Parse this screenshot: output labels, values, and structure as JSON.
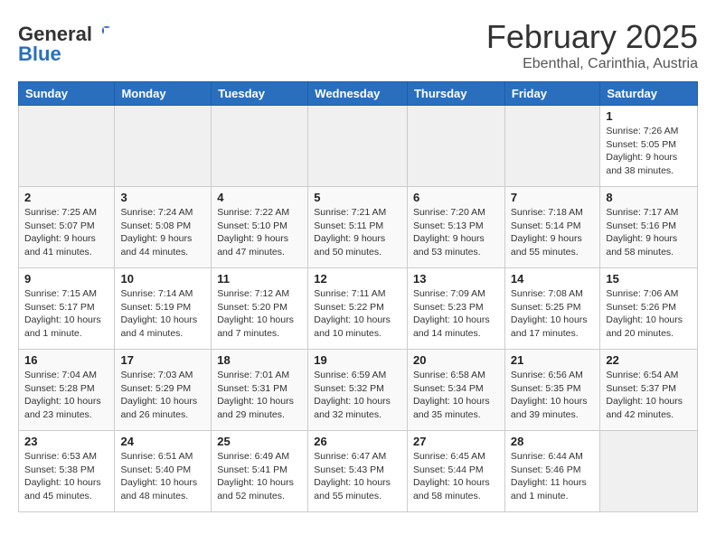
{
  "header": {
    "logo_line1": "General",
    "logo_line2": "Blue",
    "calendar_title": "February 2025",
    "calendar_subtitle": "Ebenthal, Carinthia, Austria"
  },
  "weekdays": [
    "Sunday",
    "Monday",
    "Tuesday",
    "Wednesday",
    "Thursday",
    "Friday",
    "Saturday"
  ],
  "weeks": [
    [
      {
        "day": null
      },
      {
        "day": null
      },
      {
        "day": null
      },
      {
        "day": null
      },
      {
        "day": null
      },
      {
        "day": null
      },
      {
        "day": "1",
        "sunrise": "7:26 AM",
        "sunset": "5:05 PM",
        "daylight": "9 hours and 38 minutes."
      }
    ],
    [
      {
        "day": "2",
        "sunrise": "7:25 AM",
        "sunset": "5:07 PM",
        "daylight": "9 hours and 41 minutes."
      },
      {
        "day": "3",
        "sunrise": "7:24 AM",
        "sunset": "5:08 PM",
        "daylight": "9 hours and 44 minutes."
      },
      {
        "day": "4",
        "sunrise": "7:22 AM",
        "sunset": "5:10 PM",
        "daylight": "9 hours and 47 minutes."
      },
      {
        "day": "5",
        "sunrise": "7:21 AM",
        "sunset": "5:11 PM",
        "daylight": "9 hours and 50 minutes."
      },
      {
        "day": "6",
        "sunrise": "7:20 AM",
        "sunset": "5:13 PM",
        "daylight": "9 hours and 53 minutes."
      },
      {
        "day": "7",
        "sunrise": "7:18 AM",
        "sunset": "5:14 PM",
        "daylight": "9 hours and 55 minutes."
      },
      {
        "day": "8",
        "sunrise": "7:17 AM",
        "sunset": "5:16 PM",
        "daylight": "9 hours and 58 minutes."
      }
    ],
    [
      {
        "day": "9",
        "sunrise": "7:15 AM",
        "sunset": "5:17 PM",
        "daylight": "10 hours and 1 minute."
      },
      {
        "day": "10",
        "sunrise": "7:14 AM",
        "sunset": "5:19 PM",
        "daylight": "10 hours and 4 minutes."
      },
      {
        "day": "11",
        "sunrise": "7:12 AM",
        "sunset": "5:20 PM",
        "daylight": "10 hours and 7 minutes."
      },
      {
        "day": "12",
        "sunrise": "7:11 AM",
        "sunset": "5:22 PM",
        "daylight": "10 hours and 10 minutes."
      },
      {
        "day": "13",
        "sunrise": "7:09 AM",
        "sunset": "5:23 PM",
        "daylight": "10 hours and 14 minutes."
      },
      {
        "day": "14",
        "sunrise": "7:08 AM",
        "sunset": "5:25 PM",
        "daylight": "10 hours and 17 minutes."
      },
      {
        "day": "15",
        "sunrise": "7:06 AM",
        "sunset": "5:26 PM",
        "daylight": "10 hours and 20 minutes."
      }
    ],
    [
      {
        "day": "16",
        "sunrise": "7:04 AM",
        "sunset": "5:28 PM",
        "daylight": "10 hours and 23 minutes."
      },
      {
        "day": "17",
        "sunrise": "7:03 AM",
        "sunset": "5:29 PM",
        "daylight": "10 hours and 26 minutes."
      },
      {
        "day": "18",
        "sunrise": "7:01 AM",
        "sunset": "5:31 PM",
        "daylight": "10 hours and 29 minutes."
      },
      {
        "day": "19",
        "sunrise": "6:59 AM",
        "sunset": "5:32 PM",
        "daylight": "10 hours and 32 minutes."
      },
      {
        "day": "20",
        "sunrise": "6:58 AM",
        "sunset": "5:34 PM",
        "daylight": "10 hours and 35 minutes."
      },
      {
        "day": "21",
        "sunrise": "6:56 AM",
        "sunset": "5:35 PM",
        "daylight": "10 hours and 39 minutes."
      },
      {
        "day": "22",
        "sunrise": "6:54 AM",
        "sunset": "5:37 PM",
        "daylight": "10 hours and 42 minutes."
      }
    ],
    [
      {
        "day": "23",
        "sunrise": "6:53 AM",
        "sunset": "5:38 PM",
        "daylight": "10 hours and 45 minutes."
      },
      {
        "day": "24",
        "sunrise": "6:51 AM",
        "sunset": "5:40 PM",
        "daylight": "10 hours and 48 minutes."
      },
      {
        "day": "25",
        "sunrise": "6:49 AM",
        "sunset": "5:41 PM",
        "daylight": "10 hours and 52 minutes."
      },
      {
        "day": "26",
        "sunrise": "6:47 AM",
        "sunset": "5:43 PM",
        "daylight": "10 hours and 55 minutes."
      },
      {
        "day": "27",
        "sunrise": "6:45 AM",
        "sunset": "5:44 PM",
        "daylight": "10 hours and 58 minutes."
      },
      {
        "day": "28",
        "sunrise": "6:44 AM",
        "sunset": "5:46 PM",
        "daylight": "11 hours and 1 minute."
      },
      {
        "day": null
      }
    ]
  ]
}
